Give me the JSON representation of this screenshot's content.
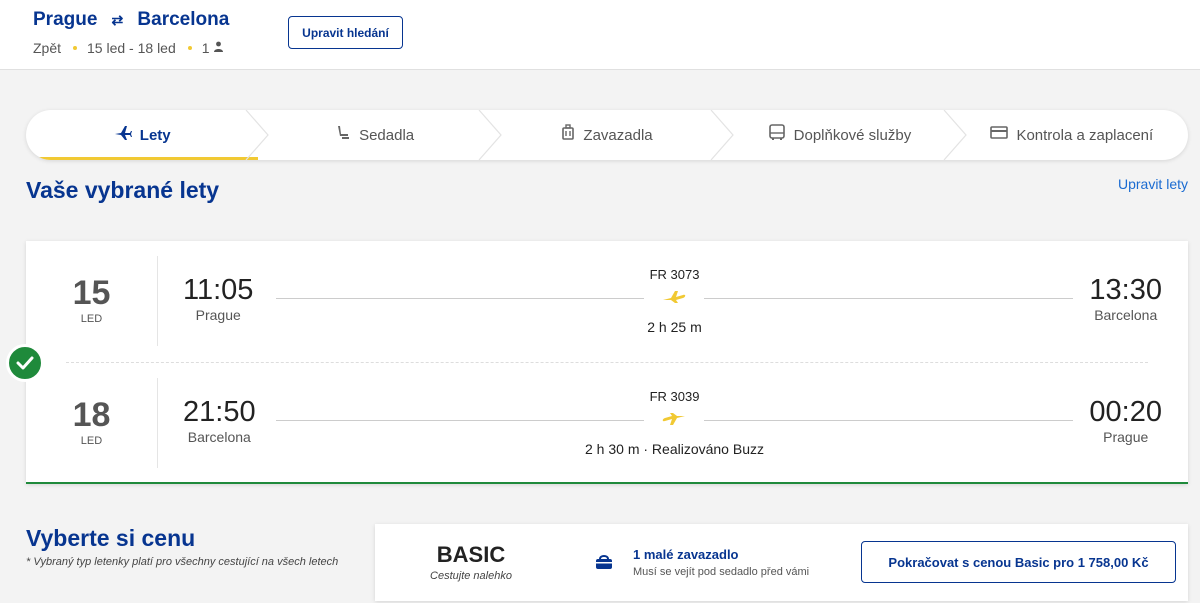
{
  "header": {
    "origin": "Prague",
    "destination": "Barcelona",
    "back_label": "Zpět",
    "dates": "15 led - 18 led",
    "passengers": "1",
    "edit_search_label": "Upravit hledání"
  },
  "steps": [
    {
      "label": "Lety",
      "icon": "plane-icon",
      "active": true
    },
    {
      "label": "Sedadla",
      "icon": "seat-icon",
      "active": false
    },
    {
      "label": "Zavazadla",
      "icon": "luggage-icon",
      "active": false
    },
    {
      "label": "Doplňkové služby",
      "icon": "bus-icon",
      "active": false
    },
    {
      "label": "Kontrola a zaplacení",
      "icon": "card-icon",
      "active": false
    }
  ],
  "selected_flights": {
    "title": "Vaše vybrané lety",
    "edit_label": "Upravit lety",
    "outbound": {
      "day": "15",
      "month": "LED",
      "dep_time": "11:05",
      "dep_city": "Prague",
      "flight_no": "FR 3073",
      "duration": "2 h 25 m",
      "arr_time": "13:30",
      "arr_city": "Barcelona"
    },
    "inbound": {
      "day": "18",
      "month": "LED",
      "dep_time": "21:50",
      "dep_city": "Barcelona",
      "flight_no": "FR 3039",
      "duration": "2 h 30 m · Realizováno Buzz",
      "arr_time": "00:20",
      "arr_city": "Prague"
    }
  },
  "price": {
    "title": "Vyberte si cenu",
    "note": "*  Vybraný typ letenky platí pro všechny cestující na všech letech",
    "fare_name": "BASIC",
    "fare_tagline": "Cestujte nalehko",
    "bag_title": "1 malé zavazadlo",
    "bag_subtitle": "Musí se vejít pod sedadlo před vámi",
    "continue_label": "Pokračovat s cenou Basic pro 1 758,00 Kč"
  },
  "colors": {
    "brand_blue": "#073590",
    "accent_yellow": "#f1c933",
    "success_green": "#1f8a3b"
  }
}
